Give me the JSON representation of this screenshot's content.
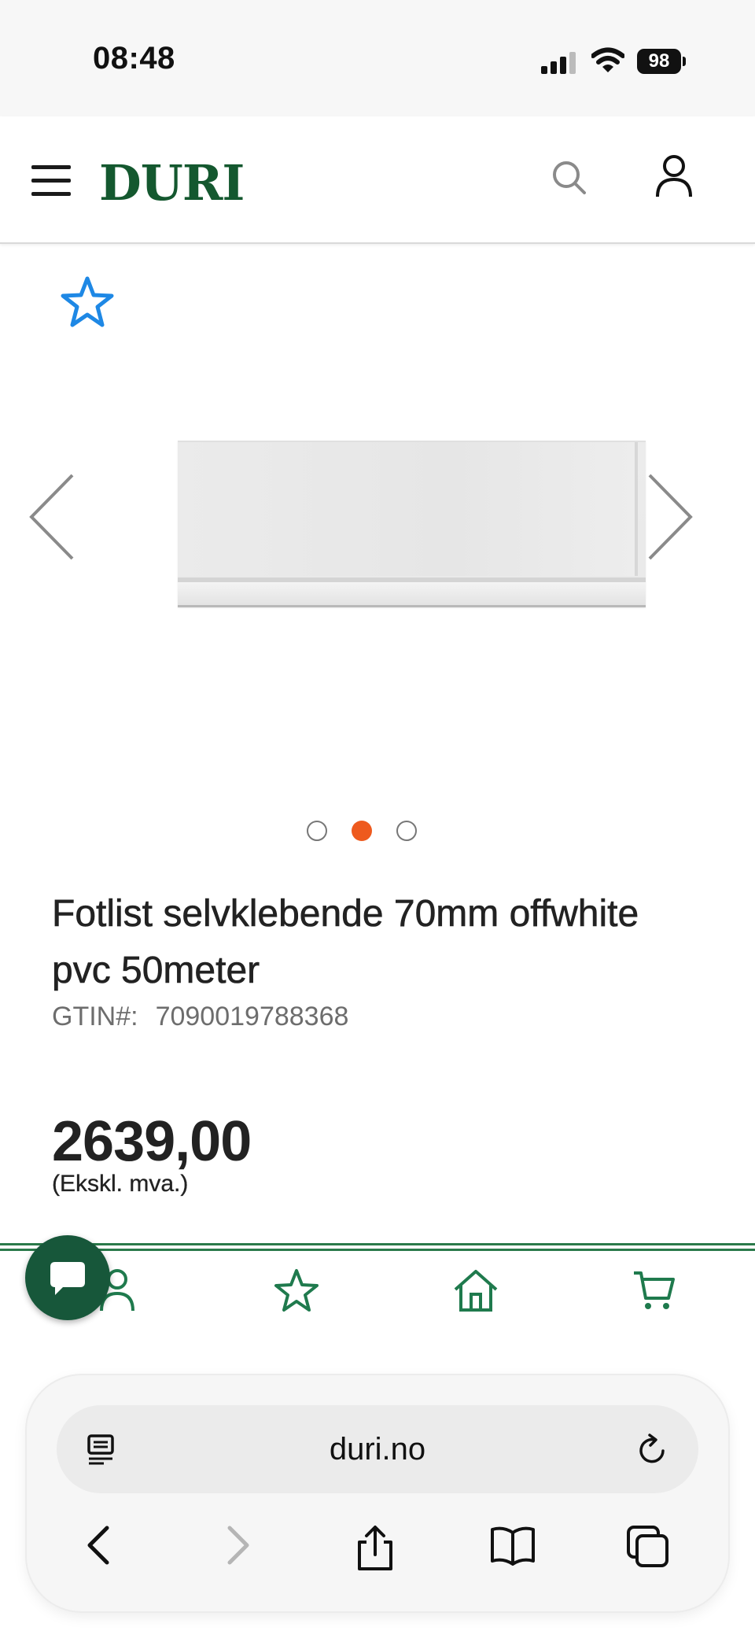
{
  "status_bar": {
    "time": "08:48",
    "battery": "98"
  },
  "header": {
    "logo": "DURI",
    "icons": [
      "menu-icon",
      "search-icon",
      "user-icon"
    ]
  },
  "gallery": {
    "favorite_icon": "star-outline-icon",
    "dots_total": 3,
    "active_dot": 2,
    "colors": {
      "active_dot": "#ee5a1e",
      "favorite": "#1e88e5"
    }
  },
  "product": {
    "title_line1": "Fotlist selvklebende 70mm  offwhite",
    "title_line2": "pvc 50meter",
    "gtin_label": "GTIN#:",
    "gtin_value": "7090019788368",
    "price": "2639,00",
    "price_note": "(Ekskl. mva.)"
  },
  "bottom_nav": {
    "items": [
      "user-icon",
      "star-icon",
      "home-icon",
      "cart-icon"
    ],
    "accent": "#1f7a4d",
    "chat_icon": "chat-bubble-icon"
  },
  "browser": {
    "url": "duri.no",
    "icons": [
      "reader-icon",
      "reload-icon",
      "back-icon",
      "forward-icon",
      "share-icon",
      "bookmarks-icon",
      "tabs-icon"
    ]
  }
}
